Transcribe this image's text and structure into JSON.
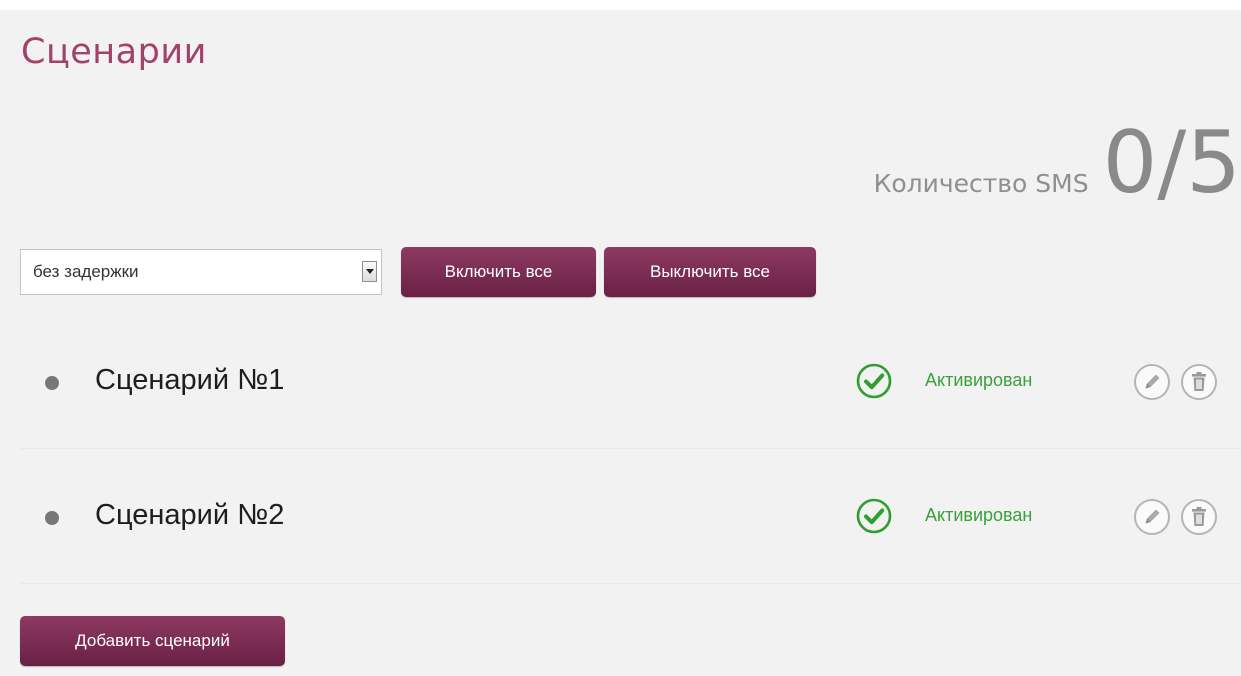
{
  "header": {
    "title": "Сценарии"
  },
  "sms": {
    "label": "Количество SMS",
    "value": "0/5"
  },
  "toolbar": {
    "delay_select": {
      "selected": "без задержки"
    },
    "enable_all_label": "Включить все",
    "disable_all_label": "Выключить все"
  },
  "scenarios": [
    {
      "name": "Сценарий №1",
      "status": "Активирован",
      "status_icon": "check-circle-icon",
      "actions": [
        "edit-icon",
        "delete-icon"
      ]
    },
    {
      "name": "Сценарий №2",
      "status": "Активирован",
      "status_icon": "check-circle-icon",
      "actions": [
        "edit-icon",
        "delete-icon"
      ]
    }
  ],
  "add_scenario_label": "Добавить сценарий",
  "colors": {
    "accent": "#7a2a52",
    "title": "#a0426a",
    "status_active": "#3aa03a"
  }
}
